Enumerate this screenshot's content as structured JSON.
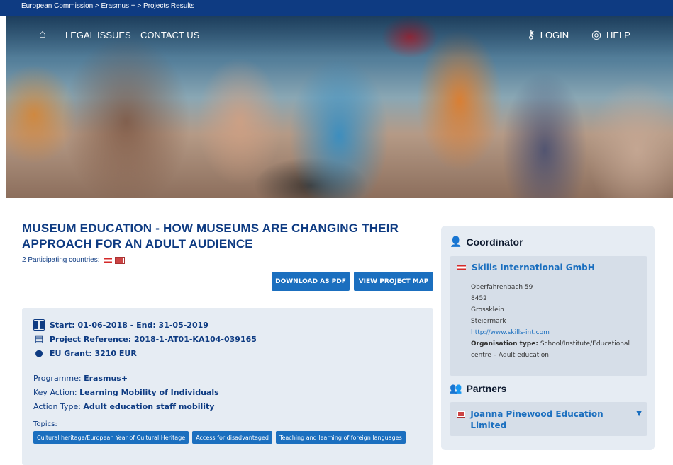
{
  "breadcrumb": "European Commission > Erasmus + > Projects Results",
  "nav": {
    "legal": "LEGAL ISSUES",
    "contact": "CONTACT US",
    "login": "LOGIN",
    "help": "HELP"
  },
  "project": {
    "title": "MUSEUM EDUCATION - HOW MUSEUMS ARE CHANGING THEIR APPROACH FOR AN ADULT AUDIENCE",
    "countries_label": "2 Participating countries:",
    "buttons": {
      "pdf": "DOWNLOAD AS PDF",
      "map": "VIEW PROJECT MAP"
    },
    "dates": "Start: 01-06-2018 - End: 31-05-2019",
    "reference": "Project Reference: 2018-1-AT01-KA104-039165",
    "grant": "EU Grant: 3210 EUR",
    "programme_label": "Programme:",
    "programme": "Erasmus+",
    "key_action_label": "Key Action:",
    "key_action": "Learning Mobility of Individuals",
    "action_type_label": "Action Type:",
    "action_type": "Adult education staff mobility",
    "topics_label": "Topics:",
    "topics": [
      "Cultural heritage/European Year of Cultural Heritage",
      "Access for disadvantaged",
      "Teaching and learning of foreign languages"
    ]
  },
  "coordinator": {
    "heading": "Coordinator",
    "name": "Skills International GmbH",
    "street": "Oberfahrenbach 59",
    "zip": "8452",
    "city": "Grossklein",
    "region": "Steiermark",
    "url": "http://www.skills-int.com",
    "org_type_label": "Organisation type:",
    "org_type": "School/Institute/Educational centre – Adult education"
  },
  "partners": {
    "heading": "Partners",
    "items": [
      {
        "name": "Joanna Pinewood Education Limited"
      }
    ]
  },
  "colors": {
    "brand": "#0e3b82",
    "button": "#1b6fbf",
    "panel": "#e6ecf3"
  }
}
